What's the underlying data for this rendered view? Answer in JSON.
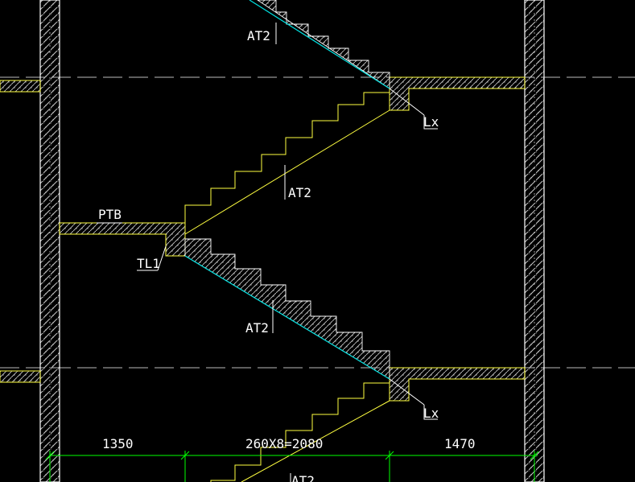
{
  "drawing": {
    "background_color": "#000000",
    "colors": {
      "wall_outline": "#ffffff",
      "hatch": "#c8c8c8",
      "stair_outline": "#ffff40",
      "stair_soffit": "#00e0e0",
      "center_line": "#bcbcbc",
      "dimension": "#00ff00",
      "label_text": "#ffffff"
    },
    "labels": {
      "stair_top": "AT2",
      "stair_upper_right": "AT2",
      "stair_middle": "AT2",
      "stair_bottom": "AT2",
      "platform_beam": "PTB",
      "landing_beam_left": "TL1",
      "beam_upper": "Lx",
      "beam_lower": "Lx"
    },
    "dimensions": {
      "left": "1350",
      "middle": "260X8=2080",
      "right": "1470"
    },
    "stair": {
      "tread_count": 8,
      "tread_width_mm": 260
    }
  }
}
